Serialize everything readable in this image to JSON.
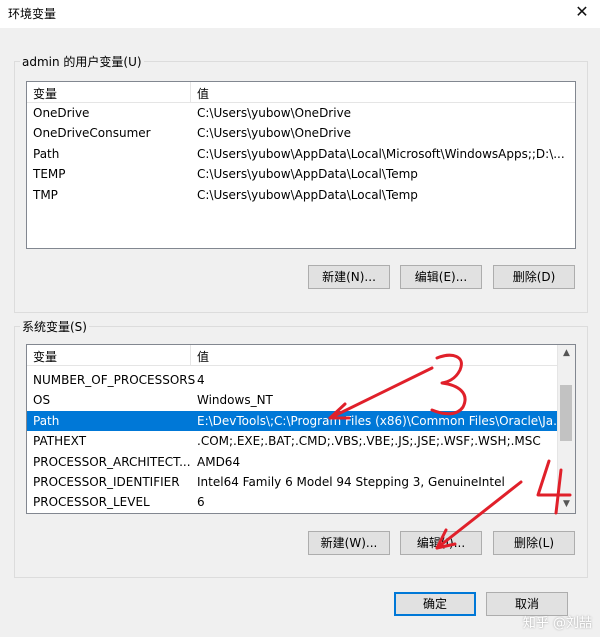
{
  "window": {
    "title": "环境变量",
    "close_glyph": "✕"
  },
  "user_section": {
    "label": "admin 的用户变量(U)",
    "columns": [
      "变量",
      "值"
    ],
    "rows": [
      {
        "name": "OneDrive",
        "value": "C:\\Users\\yubow\\OneDrive"
      },
      {
        "name": "OneDriveConsumer",
        "value": "C:\\Users\\yubow\\OneDrive"
      },
      {
        "name": "Path",
        "value": "C:\\Users\\yubow\\AppData\\Local\\Microsoft\\WindowsApps;;D:\\..."
      },
      {
        "name": "TEMP",
        "value": "C:\\Users\\yubow\\AppData\\Local\\Temp"
      },
      {
        "name": "TMP",
        "value": "C:\\Users\\yubow\\AppData\\Local\\Temp"
      }
    ],
    "buttons": {
      "new": "新建(N)...",
      "edit": "编辑(E)...",
      "delete": "删除(D)"
    }
  },
  "system_section": {
    "label": "系统变量(S)",
    "columns": [
      "变量",
      "值"
    ],
    "rows": [
      {
        "name": "NUMBER_OF_PROCESSORS",
        "value": "4"
      },
      {
        "name": "OS",
        "value": "Windows_NT"
      },
      {
        "name": "Path",
        "value": "E:\\DevTools\\;C:\\Program Files (x86)\\Common Files\\Oracle\\Ja...",
        "selected": true
      },
      {
        "name": "PATHEXT",
        "value": ".COM;.EXE;.BAT;.CMD;.VBS;.VBE;.JS;.JSE;.WSF;.WSH;.MSC"
      },
      {
        "name": "PROCESSOR_ARCHITECT...",
        "value": "AMD64"
      },
      {
        "name": "PROCESSOR_IDENTIFIER",
        "value": "Intel64 Family 6 Model 94 Stepping 3, GenuineIntel"
      },
      {
        "name": "PROCESSOR_LEVEL",
        "value": "6"
      }
    ],
    "buttons": {
      "new": "新建(W)...",
      "edit": "编辑(I)...",
      "delete": "删除(L)"
    }
  },
  "footer": {
    "ok": "确定",
    "cancel": "取消"
  },
  "annotations": {
    "num_3": "3",
    "num_4": "4",
    "color": "#e0202a"
  },
  "watermark": "知乎 @刘喆",
  "colors": {
    "selection": "#0078d7",
    "default_button_border": "#0078d7"
  }
}
